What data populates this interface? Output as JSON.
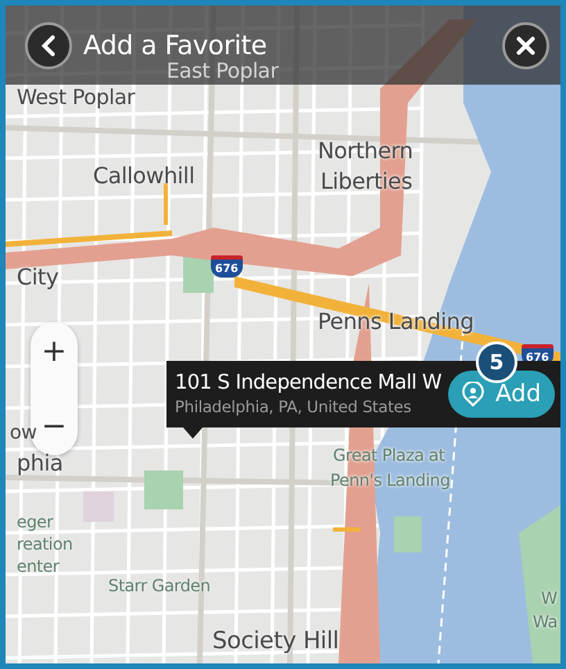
{
  "header": {
    "title": "Add a Favorite"
  },
  "map": {
    "labels": [
      {
        "text": "West Poplar",
        "kind": "district"
      },
      {
        "text": "East Poplar",
        "kind": "district"
      },
      {
        "text": "Callowhill",
        "kind": "district"
      },
      {
        "text": "Northern",
        "kind": "district"
      },
      {
        "text": "Liberties",
        "kind": "district"
      },
      {
        "text": "City",
        "kind": "district"
      },
      {
        "text": "Penns Landing",
        "kind": "district"
      },
      {
        "text": "ow",
        "kind": "district"
      },
      {
        "text": "phia",
        "kind": "district"
      },
      {
        "text": "Great Plaza at",
        "kind": "park"
      },
      {
        "text": "Penn's Landing",
        "kind": "park"
      },
      {
        "text": "eger",
        "kind": "park"
      },
      {
        "text": "reation",
        "kind": "park"
      },
      {
        "text": "enter",
        "kind": "park"
      },
      {
        "text": "Starr Garden",
        "kind": "park"
      },
      {
        "text": "Society Hill",
        "kind": "district"
      },
      {
        "text": "W",
        "kind": "park"
      },
      {
        "text": "Wa",
        "kind": "park"
      }
    ],
    "shields": [
      "676",
      "676"
    ]
  },
  "zoom_controls": [
    "+",
    "−"
  ],
  "location_popup": {
    "address": "101 S Independence Mall W",
    "locality": "Philadelphia, PA, United States",
    "button": "Add",
    "badge": "5"
  }
}
